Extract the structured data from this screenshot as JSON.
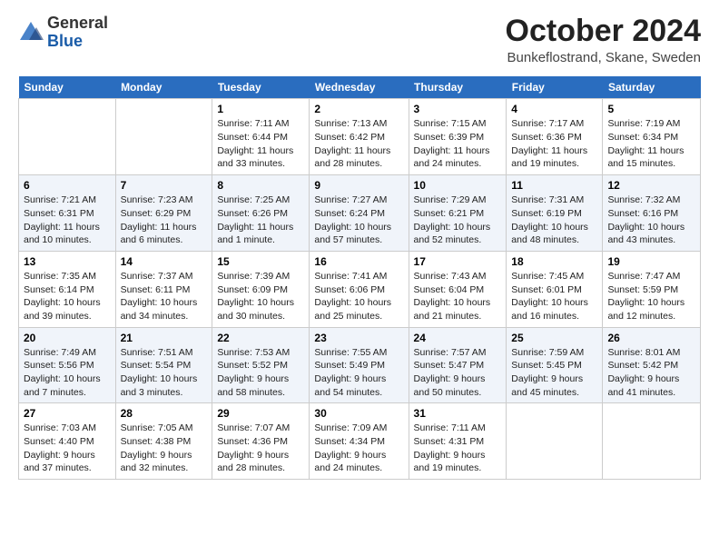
{
  "header": {
    "logo_general": "General",
    "logo_blue": "Blue",
    "month_title": "October 2024",
    "location": "Bunkeflostrand, Skane, Sweden"
  },
  "days_of_week": [
    "Sunday",
    "Monday",
    "Tuesday",
    "Wednesday",
    "Thursday",
    "Friday",
    "Saturday"
  ],
  "weeks": [
    [
      {
        "day": "",
        "content": ""
      },
      {
        "day": "",
        "content": ""
      },
      {
        "day": "1",
        "content": "Sunrise: 7:11 AM\nSunset: 6:44 PM\nDaylight: 11 hours\nand 33 minutes."
      },
      {
        "day": "2",
        "content": "Sunrise: 7:13 AM\nSunset: 6:42 PM\nDaylight: 11 hours\nand 28 minutes."
      },
      {
        "day": "3",
        "content": "Sunrise: 7:15 AM\nSunset: 6:39 PM\nDaylight: 11 hours\nand 24 minutes."
      },
      {
        "day": "4",
        "content": "Sunrise: 7:17 AM\nSunset: 6:36 PM\nDaylight: 11 hours\nand 19 minutes."
      },
      {
        "day": "5",
        "content": "Sunrise: 7:19 AM\nSunset: 6:34 PM\nDaylight: 11 hours\nand 15 minutes."
      }
    ],
    [
      {
        "day": "6",
        "content": "Sunrise: 7:21 AM\nSunset: 6:31 PM\nDaylight: 11 hours\nand 10 minutes."
      },
      {
        "day": "7",
        "content": "Sunrise: 7:23 AM\nSunset: 6:29 PM\nDaylight: 11 hours\nand 6 minutes."
      },
      {
        "day": "8",
        "content": "Sunrise: 7:25 AM\nSunset: 6:26 PM\nDaylight: 11 hours\nand 1 minute."
      },
      {
        "day": "9",
        "content": "Sunrise: 7:27 AM\nSunset: 6:24 PM\nDaylight: 10 hours\nand 57 minutes."
      },
      {
        "day": "10",
        "content": "Sunrise: 7:29 AM\nSunset: 6:21 PM\nDaylight: 10 hours\nand 52 minutes."
      },
      {
        "day": "11",
        "content": "Sunrise: 7:31 AM\nSunset: 6:19 PM\nDaylight: 10 hours\nand 48 minutes."
      },
      {
        "day": "12",
        "content": "Sunrise: 7:32 AM\nSunset: 6:16 PM\nDaylight: 10 hours\nand 43 minutes."
      }
    ],
    [
      {
        "day": "13",
        "content": "Sunrise: 7:35 AM\nSunset: 6:14 PM\nDaylight: 10 hours\nand 39 minutes."
      },
      {
        "day": "14",
        "content": "Sunrise: 7:37 AM\nSunset: 6:11 PM\nDaylight: 10 hours\nand 34 minutes."
      },
      {
        "day": "15",
        "content": "Sunrise: 7:39 AM\nSunset: 6:09 PM\nDaylight: 10 hours\nand 30 minutes."
      },
      {
        "day": "16",
        "content": "Sunrise: 7:41 AM\nSunset: 6:06 PM\nDaylight: 10 hours\nand 25 minutes."
      },
      {
        "day": "17",
        "content": "Sunrise: 7:43 AM\nSunset: 6:04 PM\nDaylight: 10 hours\nand 21 minutes."
      },
      {
        "day": "18",
        "content": "Sunrise: 7:45 AM\nSunset: 6:01 PM\nDaylight: 10 hours\nand 16 minutes."
      },
      {
        "day": "19",
        "content": "Sunrise: 7:47 AM\nSunset: 5:59 PM\nDaylight: 10 hours\nand 12 minutes."
      }
    ],
    [
      {
        "day": "20",
        "content": "Sunrise: 7:49 AM\nSunset: 5:56 PM\nDaylight: 10 hours\nand 7 minutes."
      },
      {
        "day": "21",
        "content": "Sunrise: 7:51 AM\nSunset: 5:54 PM\nDaylight: 10 hours\nand 3 minutes."
      },
      {
        "day": "22",
        "content": "Sunrise: 7:53 AM\nSunset: 5:52 PM\nDaylight: 9 hours\nand 58 minutes."
      },
      {
        "day": "23",
        "content": "Sunrise: 7:55 AM\nSunset: 5:49 PM\nDaylight: 9 hours\nand 54 minutes."
      },
      {
        "day": "24",
        "content": "Sunrise: 7:57 AM\nSunset: 5:47 PM\nDaylight: 9 hours\nand 50 minutes."
      },
      {
        "day": "25",
        "content": "Sunrise: 7:59 AM\nSunset: 5:45 PM\nDaylight: 9 hours\nand 45 minutes."
      },
      {
        "day": "26",
        "content": "Sunrise: 8:01 AM\nSunset: 5:42 PM\nDaylight: 9 hours\nand 41 minutes."
      }
    ],
    [
      {
        "day": "27",
        "content": "Sunrise: 7:03 AM\nSunset: 4:40 PM\nDaylight: 9 hours\nand 37 minutes."
      },
      {
        "day": "28",
        "content": "Sunrise: 7:05 AM\nSunset: 4:38 PM\nDaylight: 9 hours\nand 32 minutes."
      },
      {
        "day": "29",
        "content": "Sunrise: 7:07 AM\nSunset: 4:36 PM\nDaylight: 9 hours\nand 28 minutes."
      },
      {
        "day": "30",
        "content": "Sunrise: 7:09 AM\nSunset: 4:34 PM\nDaylight: 9 hours\nand 24 minutes."
      },
      {
        "day": "31",
        "content": "Sunrise: 7:11 AM\nSunset: 4:31 PM\nDaylight: 9 hours\nand 19 minutes."
      },
      {
        "day": "",
        "content": ""
      },
      {
        "day": "",
        "content": ""
      }
    ]
  ]
}
